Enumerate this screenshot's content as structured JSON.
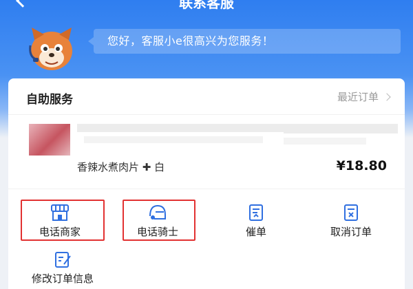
{
  "header": {
    "title": "联系客服",
    "greeting": "您好，客服小e很高兴为您服务！"
  },
  "self_service": {
    "title": "自助服务",
    "recent_orders_label": "最近订单"
  },
  "order": {
    "item_name": "香辣水煮肉片 ✚ 白",
    "price": "¥18.80"
  },
  "actions": [
    {
      "label": "电话商家",
      "icon": "store-icon"
    },
    {
      "label": "电话骑士",
      "icon": "rider-helmet-icon"
    },
    {
      "label": "催单",
      "icon": "urge-order-icon"
    },
    {
      "label": "取消订单",
      "icon": "cancel-order-icon"
    },
    {
      "label": "修改订单信息",
      "icon": "edit-order-icon"
    }
  ],
  "colors": {
    "accent": "#2f7ef0",
    "highlight": "#e23131",
    "icon": "#2f6fe0"
  }
}
